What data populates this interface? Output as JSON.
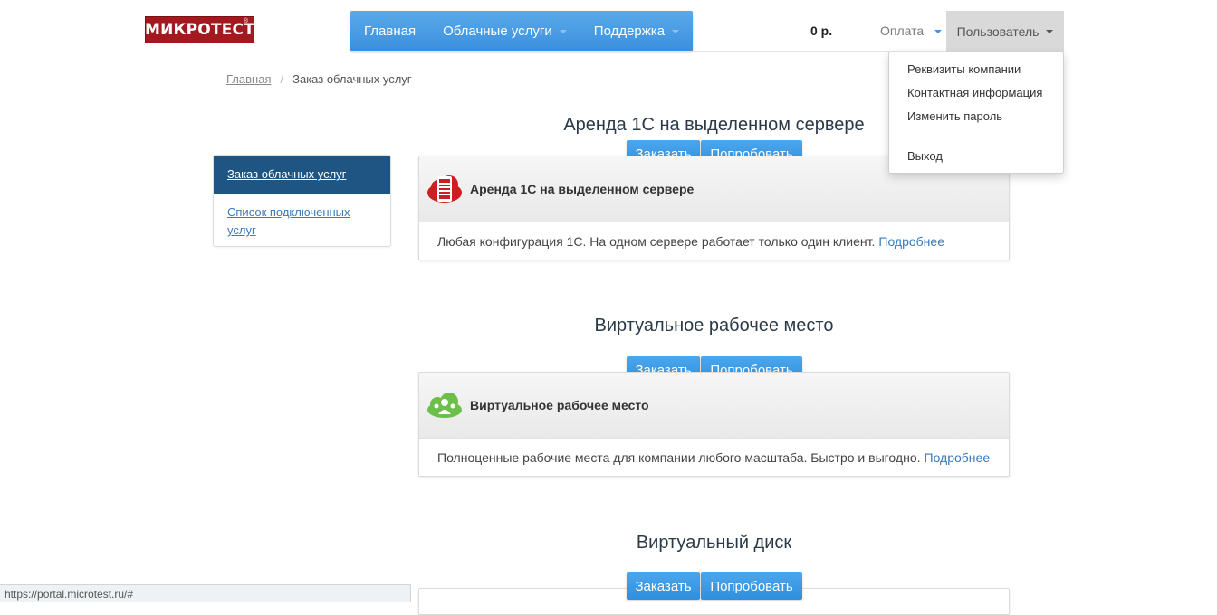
{
  "header": {
    "logo_text": "МИКРОТЕСТ",
    "logo_reg": "®",
    "nav": [
      {
        "label": "Главная"
      },
      {
        "label": "Облачные услуги"
      },
      {
        "label": "Поддержка"
      }
    ],
    "balance": "0 р.",
    "pay_label": "Оплата",
    "user_label": "Пользователь"
  },
  "user_menu": {
    "items": [
      "Реквизиты компании",
      "Контактная информация",
      "Изменить пароль"
    ],
    "logout": "Выход"
  },
  "breadcrumb": {
    "home": "Главная",
    "separator": "/",
    "current": "Заказ облачных услуг"
  },
  "sidebar": {
    "active": "Заказ облачных услуг",
    "link": "Список подключенных услуг"
  },
  "services": [
    {
      "title": "Аренда 1С на выделенном сервере",
      "order_label": "Заказать",
      "try_label": "Попробовать",
      "card_name": "Аренда 1С на выделенном сервере",
      "description": "Любая конфигурация 1С. На одном сервере работает только один клиент.",
      "more_label": "Подробнее",
      "icon": "red-server-cloud-icon",
      "color": "#cc1f1f"
    },
    {
      "title": "Виртуальное рабочее место",
      "order_label": "Заказать",
      "try_label": "Попробовать",
      "card_name": "Виртуальное рабочее место",
      "description": "Полноценные рабочие места для компании любого масштаба. Быстро и выгодно.",
      "more_label": "Подробнее",
      "icon": "green-users-cloud-icon",
      "color": "#6cc04a"
    },
    {
      "title": "Виртуальный диск",
      "order_label": "Заказать",
      "try_label": "Попробовать"
    }
  ],
  "status_bar": {
    "url": "https://portal.microtest.ru/#"
  }
}
